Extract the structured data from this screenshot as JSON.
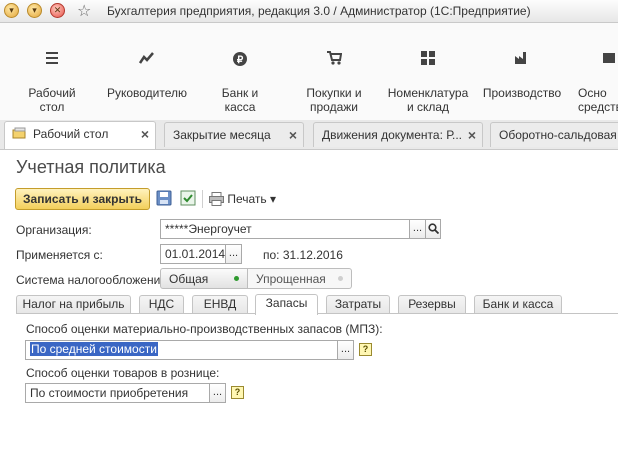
{
  "window": {
    "title": "Бухгалтерия предприятия, редакция 3.0 / Администратор  (1С:Предприятие)",
    "buttons": [
      "▾",
      "▾",
      "✕"
    ]
  },
  "sections": [
    {
      "label": "Рабочий\nстол",
      "icon": "menu-icon"
    },
    {
      "label": "Руководителю",
      "icon": "trend-icon"
    },
    {
      "label": "Банк и\nкасса",
      "icon": "ruble-icon"
    },
    {
      "label": "Покупки и\nпродажи",
      "icon": "cart-icon"
    },
    {
      "label": "Номенклатура\nи склад",
      "icon": "grid-icon"
    },
    {
      "label": "Производство",
      "icon": "factory-icon"
    },
    {
      "label": "Осно\nсредств",
      "icon": "assets-icon"
    }
  ],
  "open_tabs": [
    {
      "label": "Рабочий стол",
      "active": true
    },
    {
      "label": "Закрытие месяца"
    },
    {
      "label": "Движения документа: Р..."
    },
    {
      "label": "Оборотно-сальдовая ве"
    }
  ],
  "form": {
    "title": "Учетная политика",
    "save_close": "Записать и закрыть",
    "print": "Печать",
    "org_label": "Организация:",
    "org_value": "*****Энергоучет",
    "applies_label": "Применяется с:",
    "applies_value": "01.01.2014",
    "applies_to": "по: 31.12.2016",
    "tax_label": "Система налогообложения:",
    "tax_general": "Общая",
    "tax_simplified": "Упрощенная"
  },
  "inner_tabs": [
    "Налог на прибыль",
    "НДС",
    "ЕНВД",
    "Запасы",
    "Затраты",
    "Резервы",
    "Банк и касса"
  ],
  "inner_tab_active": "Запасы",
  "panel": {
    "mpz_label": "Способ оценки материально-производственных запасов (МПЗ):",
    "mpz_value": "По средней стоимости",
    "retail_label": "Способ оценки товаров в рознице:",
    "retail_value": "По стоимости приобретения"
  },
  "glyphs": {
    "dots": "...",
    "question": "?",
    "magnifier": "⌕",
    "dropdown": "▾",
    "star": "☆"
  },
  "colors": {
    "accent": "#f3cf5b",
    "selection": "#3a66c4",
    "title_text": "#4b4b4b"
  }
}
